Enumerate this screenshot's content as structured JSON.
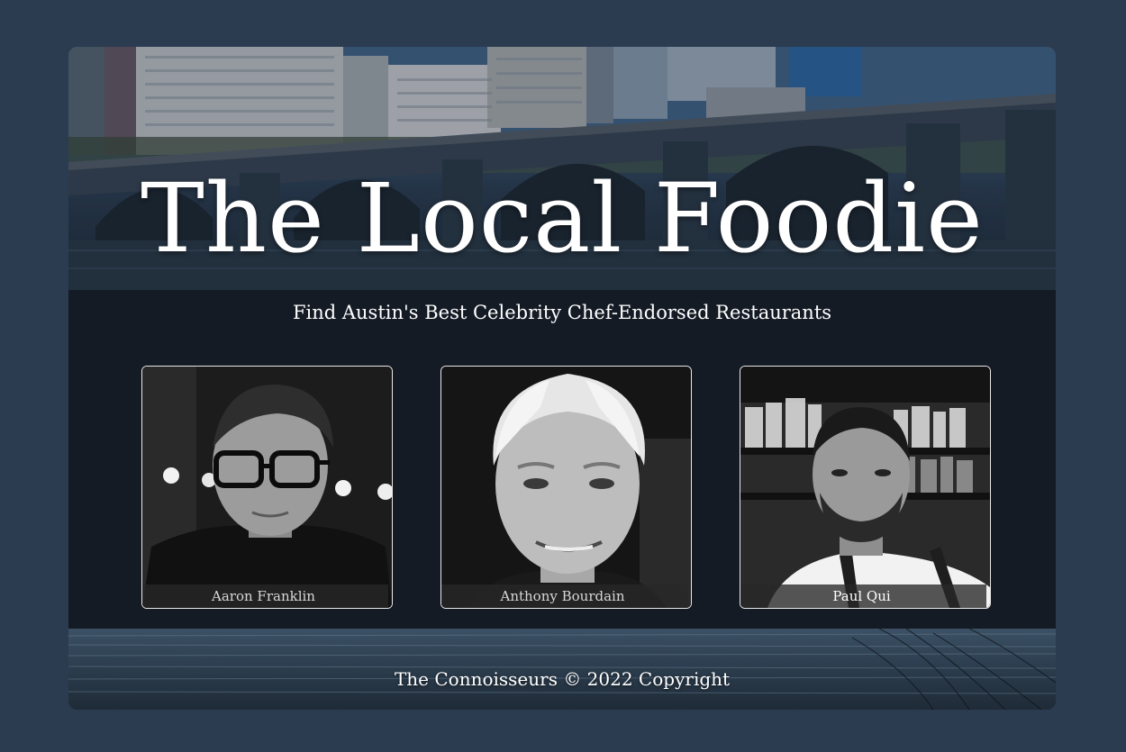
{
  "hero": {
    "title": "The Local Foodie",
    "tagline": "Find Austin's Best Celebrity Chef-Endorsed Restaurants"
  },
  "chefs": [
    {
      "name": "Aaron Franklin"
    },
    {
      "name": "Anthony Bourdain"
    },
    {
      "name": "Paul Qui"
    }
  ],
  "footer": {
    "text": "The Connoisseurs © 2022 Copyright"
  },
  "colors": {
    "page_background": "#2b3b50",
    "card_background": "#141b25",
    "text": "#ffffff"
  }
}
